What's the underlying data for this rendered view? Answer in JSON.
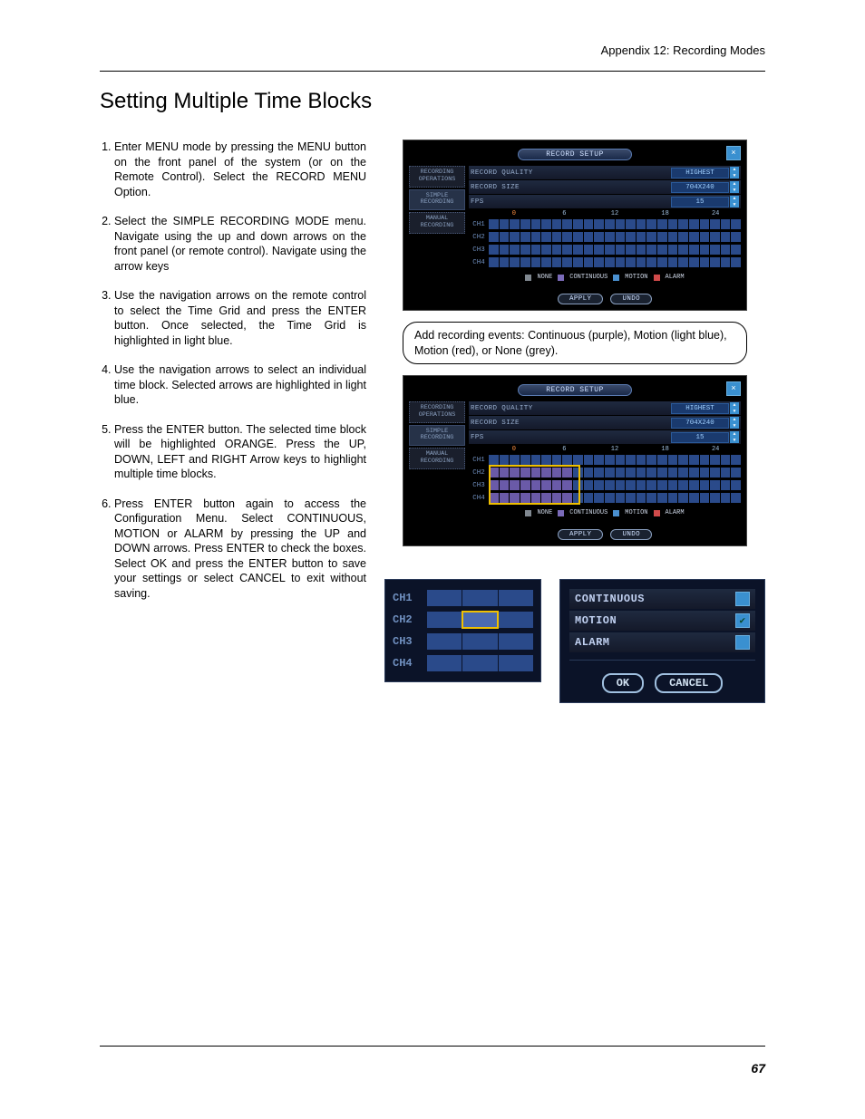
{
  "header": {
    "appendix": "Appendix 12: Recording Modes"
  },
  "title": "Setting Multiple Time Blocks",
  "page_number": "67",
  "steps": [
    "Enter MENU mode by pressing the MENU button on the front panel of the system (or on the Remote Control). Select the RECORD MENU Option.",
    "Select the SIMPLE RECORDING MODE menu. Navigate using the up and down arrows on the front panel (or remote control). Navigate using the arrow keys",
    "Use the navigation arrows on the remote control to select the Time Grid and press the ENTER button. Once selected, the Time Grid is highlighted in light blue.",
    "Use the navigation arrows to select an individual time block. Selected arrows are highlighted in light blue.",
    "Press the ENTER button. The selected time block will be highlighted ORANGE. Press the UP, DOWN, LEFT and RIGHT Arrow keys to highlight multiple time blocks.",
    "Press ENTER button again to access the Configuration Menu. Select CONTINUOUS, MOTION or ALARM by pressing the UP and DOWN arrows. Press ENTER to check the boxes. Select OK and press the ENTER button to save your settings or select CANCEL to exit without saving."
  ],
  "callout": "Add recording events: Continuous (purple), Motion (light blue), Motion (red), or None (grey).",
  "panel": {
    "title": "RECORD SETUP",
    "tabs": {
      "ops": "RECORDING OPERATIONS",
      "simple": "SIMPLE RECORDING",
      "manual": "MANUAL RECORDING"
    },
    "fields": {
      "quality_label": "RECORD QUALITY",
      "quality_value": "HIGHEST",
      "size_label": "RECORD SIZE",
      "size_value": "704X240",
      "fps_label": "FPS",
      "fps_value": "15"
    },
    "axis": [
      "0",
      "6",
      "12",
      "18",
      "24"
    ],
    "channels": [
      "CH1",
      "CH2",
      "CH3",
      "CH4"
    ],
    "legend": {
      "none": "NONE",
      "cont": "CONTINUOUS",
      "motion": "MOTION",
      "alarm": "ALARM"
    },
    "colors": {
      "none": "#808890",
      "cont": "#7a6ab8",
      "motion": "#4a90d0",
      "alarm": "#d04a4a"
    },
    "buttons": {
      "apply": "APPLY",
      "undo": "UNDO"
    }
  },
  "ch_panel": {
    "channels": [
      "CH1",
      "CH2",
      "CH3",
      "CH4"
    ],
    "selected_row": 1,
    "selected_col": 1
  },
  "cfg_panel": {
    "options": [
      {
        "label": "CONTINUOUS",
        "checked": false
      },
      {
        "label": "MOTION",
        "checked": true
      },
      {
        "label": "ALARM",
        "checked": false
      }
    ],
    "ok": "OK",
    "cancel": "CANCEL"
  }
}
